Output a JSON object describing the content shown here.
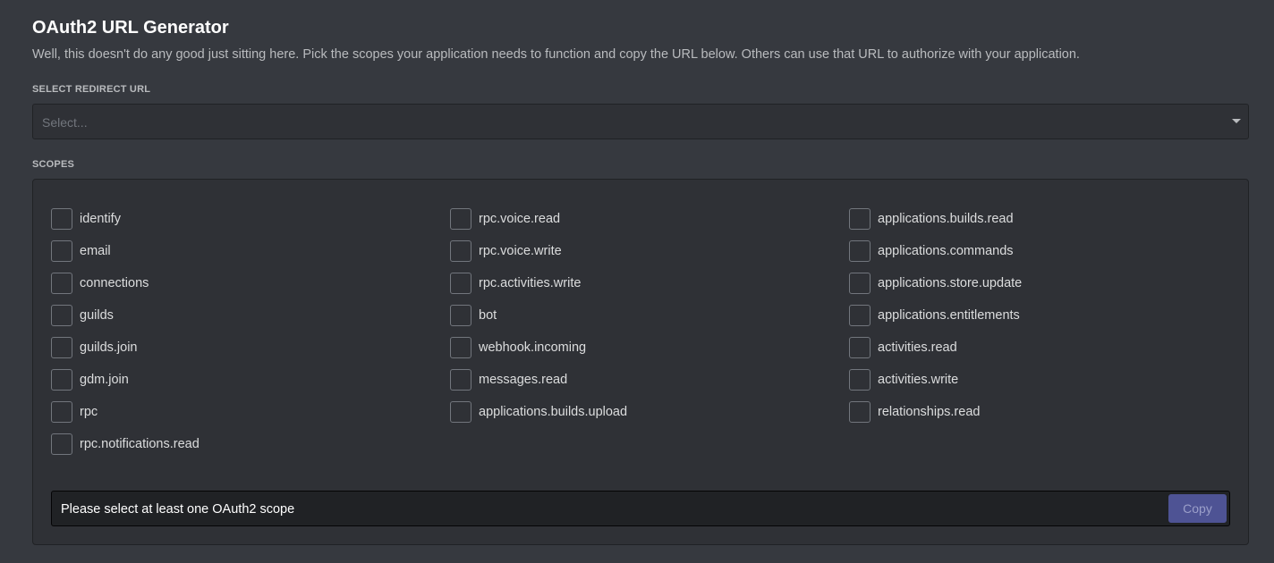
{
  "header": {
    "title": "OAuth2 URL Generator",
    "subtitle": "Well, this doesn't do any good just sitting here. Pick the scopes your application needs to function and copy the URL below. Others can use that URL to authorize with your application."
  },
  "redirect": {
    "label": "SELECT REDIRECT URL",
    "placeholder": "Select..."
  },
  "scopes": {
    "label": "SCOPES",
    "columns": [
      [
        "identify",
        "email",
        "connections",
        "guilds",
        "guilds.join",
        "gdm.join",
        "rpc",
        "rpc.notifications.read"
      ],
      [
        "rpc.voice.read",
        "rpc.voice.write",
        "rpc.activities.write",
        "bot",
        "webhook.incoming",
        "messages.read",
        "applications.builds.upload"
      ],
      [
        "applications.builds.read",
        "applications.commands",
        "applications.store.update",
        "applications.entitlements",
        "activities.read",
        "activities.write",
        "relationships.read"
      ]
    ]
  },
  "generated_url": {
    "text": "Please select at least one OAuth2 scope",
    "copy_label": "Copy"
  }
}
